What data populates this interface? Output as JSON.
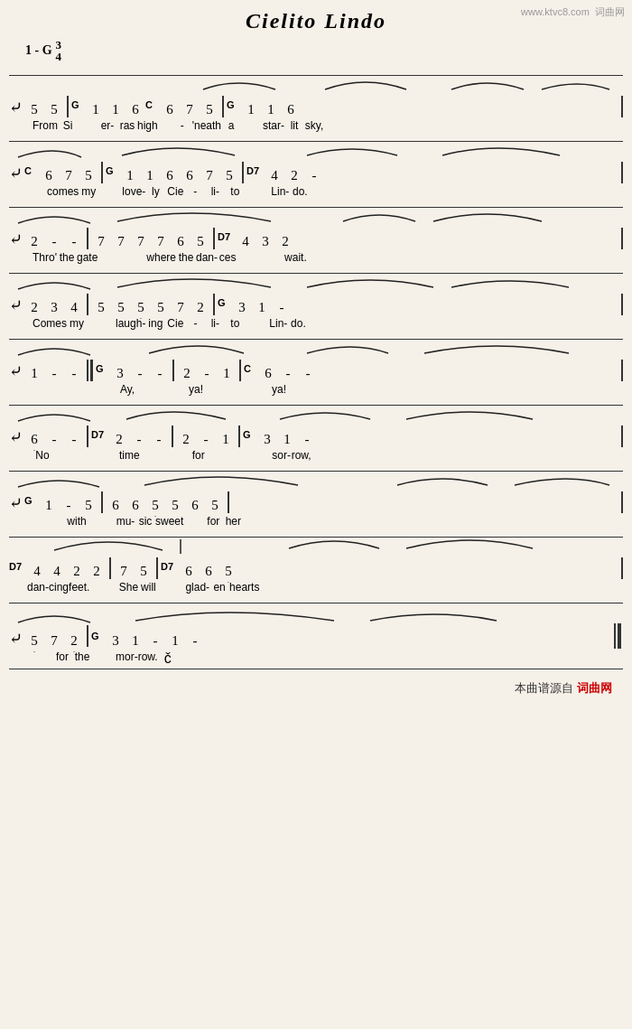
{
  "title": "Cielito  Lindo",
  "watermark": "www.ktvc8.com  词曲网",
  "time_sig": "1 - G",
  "source_label": "本曲谱源自",
  "source_site": "词曲网",
  "lines": [
    {
      "id": "line1",
      "numbers": [
        "5",
        "5",
        "1",
        "1",
        "6",
        "6",
        "7",
        "5",
        "1",
        "1",
        "6"
      ],
      "chords": {
        "0": "",
        "2": "G",
        "7": "C",
        "9": "G"
      },
      "lyrics": [
        "From",
        "Si",
        "-",
        "er-ras",
        "high",
        "-",
        "'neath",
        "a",
        "star-",
        "lit",
        "sky,"
      ]
    }
  ]
}
